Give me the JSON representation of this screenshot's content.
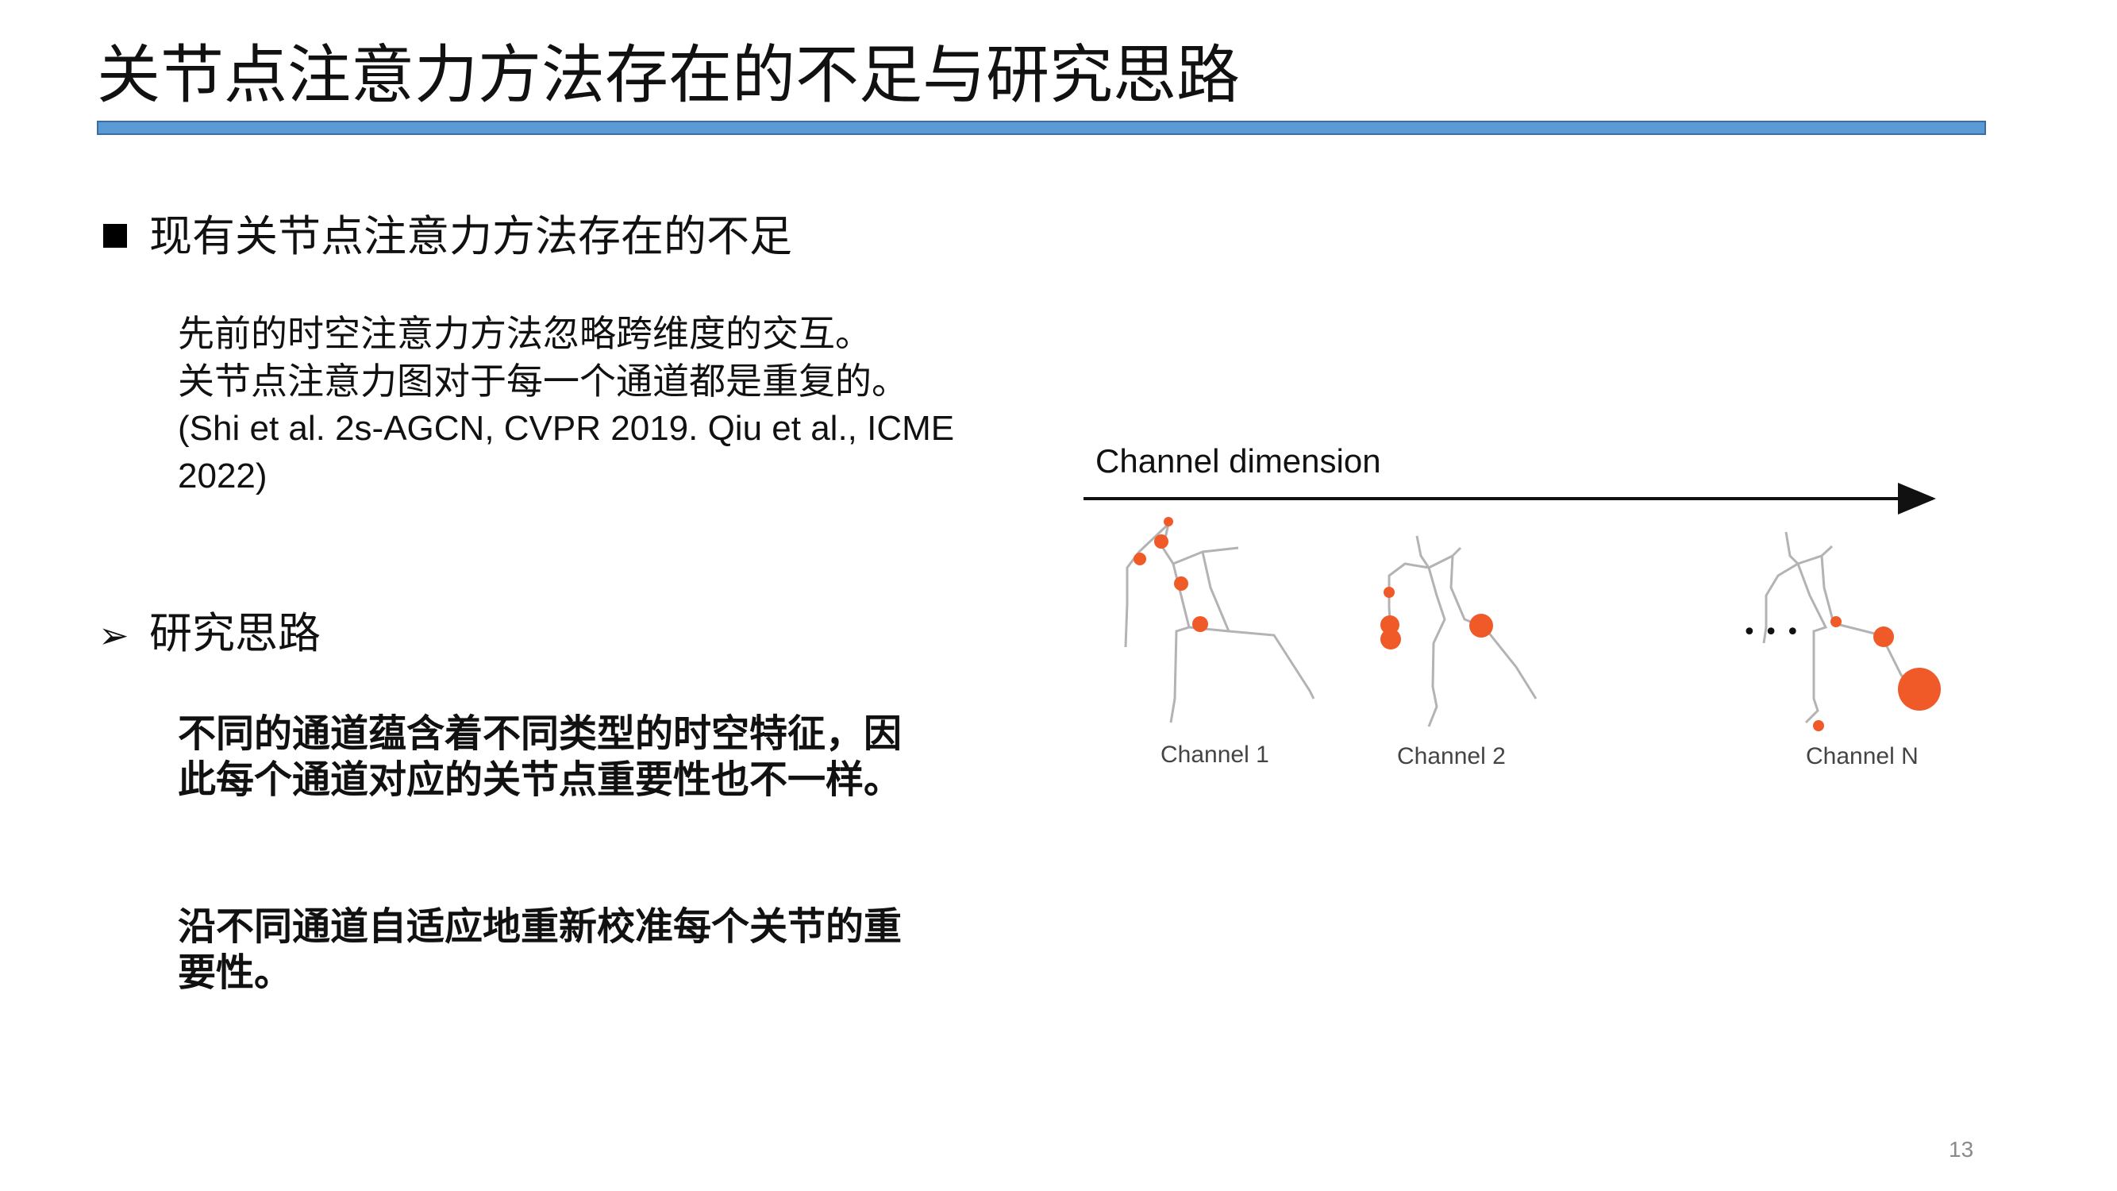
{
  "slide": {
    "title": "关节点注意力方法存在的不足与研究思路",
    "page_number": "13"
  },
  "section1": {
    "heading": "现有关节点注意力方法存在的不足",
    "lines": [
      "先前的时空注意力方法忽略跨维度的交互。",
      "关节点注意力图对于每一个通道都是重复的。"
    ],
    "citation": "(Shi et al. 2s-AGCN, CVPR 2019. Qiu et al., ICME 2022)"
  },
  "section2": {
    "heading": "研究思路",
    "para1": "不同的通道蕴含着不同类型的时空特征，因此每个通道对应的关节点重要性也不一样。",
    "para2": "沿不同通道自适应地重新校准每个关节的重要性。"
  },
  "figure": {
    "axis_label": "Channel dimension",
    "ellipsis": "• • •",
    "channels": [
      {
        "label": "Channel 1"
      },
      {
        "label": "Channel 2"
      },
      {
        "label": "Channel N"
      }
    ],
    "colors": {
      "skeleton": "#b3b3b3",
      "joint": "#f05a28",
      "arrow": "#111111"
    }
  },
  "colors": {
    "title_rule_fill": "#5b9bd5",
    "title_rule_border": "#3c6d9e"
  }
}
